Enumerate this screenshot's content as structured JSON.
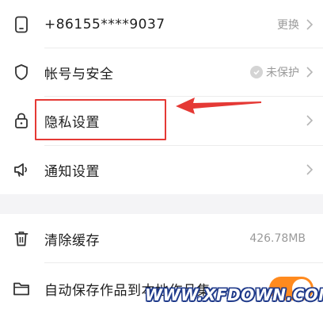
{
  "account_settings": {
    "phone_row": {
      "label": "+86155****9037",
      "action_text": "更换",
      "icon": "phone-icon"
    },
    "security_row": {
      "label": "帐号与安全",
      "status_text": "未保护",
      "icon": "shield-icon",
      "status_icon": "check-circle-icon"
    },
    "privacy_row": {
      "label": "隐私设置",
      "icon": "lock-icon"
    },
    "notification_row": {
      "label": "通知设置",
      "icon": "speaker-icon"
    }
  },
  "storage_settings": {
    "clear_cache_row": {
      "label": "清除缓存",
      "size_text": "426.78MB",
      "icon": "trash-icon"
    },
    "auto_save_row": {
      "label": "自动保存作品到本地作品集",
      "icon": "folder-icon",
      "toggle_on": true
    }
  },
  "annotation": {
    "highlight_color": "#e53935",
    "arrow_color": "#e53935"
  },
  "watermark": {
    "text": "WWW.XFDOWN.COM"
  },
  "colors": {
    "accent": "#ff8a1e",
    "background": "#f4f4f6",
    "secondary_text": "#9a9a9a"
  }
}
